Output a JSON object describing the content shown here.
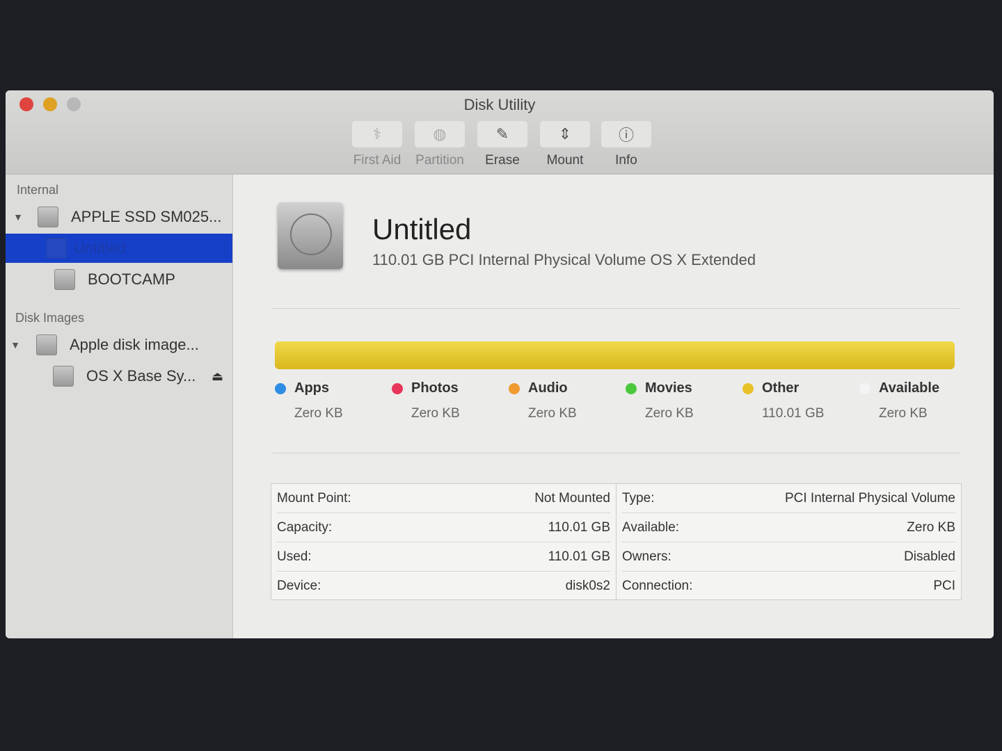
{
  "window": {
    "title": "Disk Utility"
  },
  "toolbar": [
    {
      "label": "First Aid",
      "icon": "stethoscope-icon",
      "glyph": "⚕",
      "enabled": false
    },
    {
      "label": "Partition",
      "icon": "partition-icon",
      "glyph": "◍",
      "enabled": false
    },
    {
      "label": "Erase",
      "icon": "erase-icon",
      "glyph": "✎",
      "enabled": true
    },
    {
      "label": "Mount",
      "icon": "mount-icon",
      "glyph": "⇕",
      "enabled": true
    },
    {
      "label": "Info",
      "icon": "info-icon",
      "glyph": "ⓘ",
      "enabled": true
    }
  ],
  "sidebar": {
    "internal_label": "Internal",
    "disk_images_label": "Disk Images",
    "items": [
      {
        "label": "APPLE SSD SM025..."
      },
      {
        "label": "Untitled",
        "selected": true
      },
      {
        "label": "BOOTCAMP"
      },
      {
        "label": "Apple disk image..."
      },
      {
        "label": "OS X Base Sy...",
        "eject": "⏏"
      }
    ]
  },
  "volume": {
    "name": "Untitled",
    "description": "110.01 GB PCI Internal Physical Volume OS X Extended",
    "used_fraction": 1.0
  },
  "legend": [
    {
      "name": "Apps",
      "value": "Zero KB",
      "color": "#2f8de4"
    },
    {
      "name": "Photos",
      "value": "Zero KB",
      "color": "#e8365a"
    },
    {
      "name": "Audio",
      "value": "Zero KB",
      "color": "#f09a30"
    },
    {
      "name": "Movies",
      "value": "Zero KB",
      "color": "#4cc83c"
    },
    {
      "name": "Other",
      "value": "110.01 GB",
      "color": "#e8c228"
    },
    {
      "name": "Available",
      "value": "Zero KB",
      "color": "#f4f4f4"
    }
  ],
  "info": {
    "left": [
      {
        "k": "Mount Point:",
        "v": "Not Mounted"
      },
      {
        "k": "Capacity:",
        "v": "110.01 GB"
      },
      {
        "k": "Used:",
        "v": "110.01 GB"
      },
      {
        "k": "Device:",
        "v": "disk0s2"
      }
    ],
    "right": [
      {
        "k": "Type:",
        "v": "PCI Internal Physical Volume"
      },
      {
        "k": "Available:",
        "v": "Zero KB"
      },
      {
        "k": "Owners:",
        "v": "Disabled"
      },
      {
        "k": "Connection:",
        "v": "PCI"
      }
    ]
  }
}
